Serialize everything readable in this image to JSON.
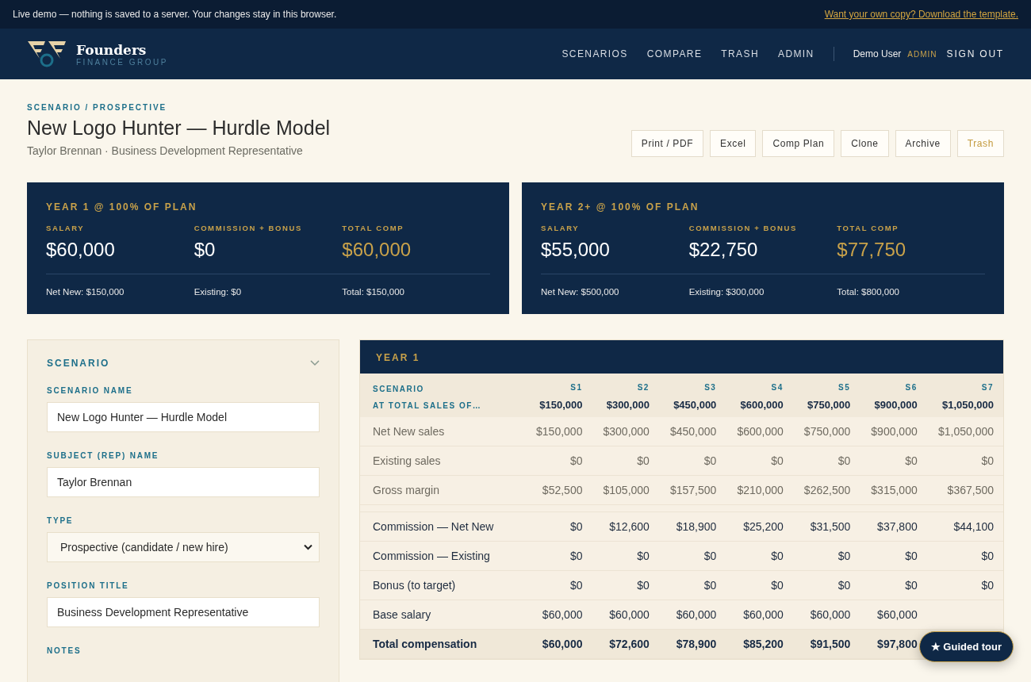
{
  "banner": {
    "text": "Live demo — nothing is saved to a server. Your changes stay in this browser.",
    "link": "Want your own copy? Download the template."
  },
  "brand": {
    "name": "Founders",
    "tagline": "FINANCE GROUP"
  },
  "nav": [
    {
      "label": "SCENARIOS"
    },
    {
      "label": "COMPARE"
    },
    {
      "label": "TRASH"
    },
    {
      "label": "ADMIN"
    }
  ],
  "user": {
    "name": "Demo User",
    "role": "ADMIN",
    "signout": "SIGN OUT"
  },
  "header": {
    "breadcrumb": "SCENARIO / PROSPECTIVE",
    "title": "New Logo Hunter — Hurdle Model",
    "subtitle": "Taylor Brennan · Business Development Representative"
  },
  "actions": [
    {
      "label": "Print / PDF",
      "kind": "normal"
    },
    {
      "label": "Excel",
      "kind": "normal"
    },
    {
      "label": "Comp Plan",
      "kind": "normal"
    },
    {
      "label": "Clone",
      "kind": "normal"
    },
    {
      "label": "Archive",
      "kind": "normal"
    },
    {
      "label": "Trash",
      "kind": "danger"
    }
  ],
  "summaries": [
    {
      "title": "YEAR 1 @ 100% OF PLAN",
      "metrics": [
        {
          "label": "SALARY",
          "value": "$60,000",
          "kind": "plain"
        },
        {
          "label": "COMMISSION + BONUS",
          "value": "$0",
          "kind": "plain"
        },
        {
          "label": "TOTAL COMP",
          "value": "$60,000",
          "kind": "total"
        }
      ],
      "footer": [
        "Net New: $150,000",
        "Existing: $0",
        "Total: $150,000"
      ]
    },
    {
      "title": "YEAR 2+ @ 100% OF PLAN",
      "metrics": [
        {
          "label": "SALARY",
          "value": "$55,000",
          "kind": "plain"
        },
        {
          "label": "COMMISSION + BONUS",
          "value": "$22,750",
          "kind": "plain"
        },
        {
          "label": "TOTAL COMP",
          "value": "$77,750",
          "kind": "total"
        }
      ],
      "footer": [
        "Net New: $500,000",
        "Existing: $300,000",
        "Total: $800,000"
      ]
    }
  ],
  "scenario_panel": {
    "title": "SCENARIO",
    "expanded": true,
    "fields": [
      {
        "label": "SCENARIO NAME",
        "kind": "text",
        "value": "New Logo Hunter — Hurdle Model"
      },
      {
        "label": "SUBJECT (REP) NAME",
        "kind": "text",
        "value": "Taylor Brennan"
      },
      {
        "label": "TYPE",
        "kind": "select",
        "value": "Prospective (candidate / new hire)"
      },
      {
        "label": "POSITION TITLE",
        "kind": "text",
        "value": "Business Development Representative"
      },
      {
        "label": "NOTES",
        "kind": "label"
      }
    ]
  },
  "table": {
    "title": "YEAR 1",
    "header_label_1": "SCENARIO",
    "header_label_2": "AT TOTAL SALES OF…",
    "columns": [
      {
        "name": "S1",
        "total": "$150,000"
      },
      {
        "name": "S2",
        "total": "$300,000"
      },
      {
        "name": "S3",
        "total": "$450,000"
      },
      {
        "name": "S4",
        "total": "$600,000"
      },
      {
        "name": "S5",
        "total": "$750,000"
      },
      {
        "name": "S6",
        "total": "$900,000"
      },
      {
        "name": "S7",
        "total": "$1,050,000"
      }
    ],
    "rows": [
      {
        "kind": "input",
        "label": "Net New sales",
        "cells": [
          "$150,000",
          "$300,000",
          "$450,000",
          "$600,000",
          "$750,000",
          "$900,000",
          "$1,050,000"
        ]
      },
      {
        "kind": "input",
        "label": "Existing sales",
        "cells": [
          "$0",
          "$0",
          "$0",
          "$0",
          "$0",
          "$0",
          "$0"
        ]
      },
      {
        "kind": "input",
        "label": "Gross margin",
        "cells": [
          "$52,500",
          "$105,000",
          "$157,500",
          "$210,000",
          "$262,500",
          "$315,000",
          "$367,500"
        ]
      },
      {
        "kind": "spacer"
      },
      {
        "kind": "output",
        "label": "Commission — Net New",
        "cells": [
          "$0",
          "$12,600",
          "$18,900",
          "$25,200",
          "$31,500",
          "$37,800",
          "$44,100"
        ]
      },
      {
        "kind": "output",
        "label": "Commission — Existing",
        "cells": [
          "$0",
          "$0",
          "$0",
          "$0",
          "$0",
          "$0",
          "$0"
        ]
      },
      {
        "kind": "output",
        "label": "Bonus (to target)",
        "cells": [
          "$0",
          "$0",
          "$0",
          "$0",
          "$0",
          "$0",
          "$0"
        ]
      },
      {
        "kind": "output",
        "label": "Base salary",
        "cells": [
          "$60,000",
          "$60,000",
          "$60,000",
          "$60,000",
          "$60,000",
          "$60,000"
        ]
      },
      {
        "kind": "total",
        "label": "Total compensation",
        "cells": [
          "$60,000",
          "$72,600",
          "$78,900",
          "$85,200",
          "$91,500",
          "$97,800"
        ]
      }
    ]
  },
  "tour_button": "★ Guided tour"
}
